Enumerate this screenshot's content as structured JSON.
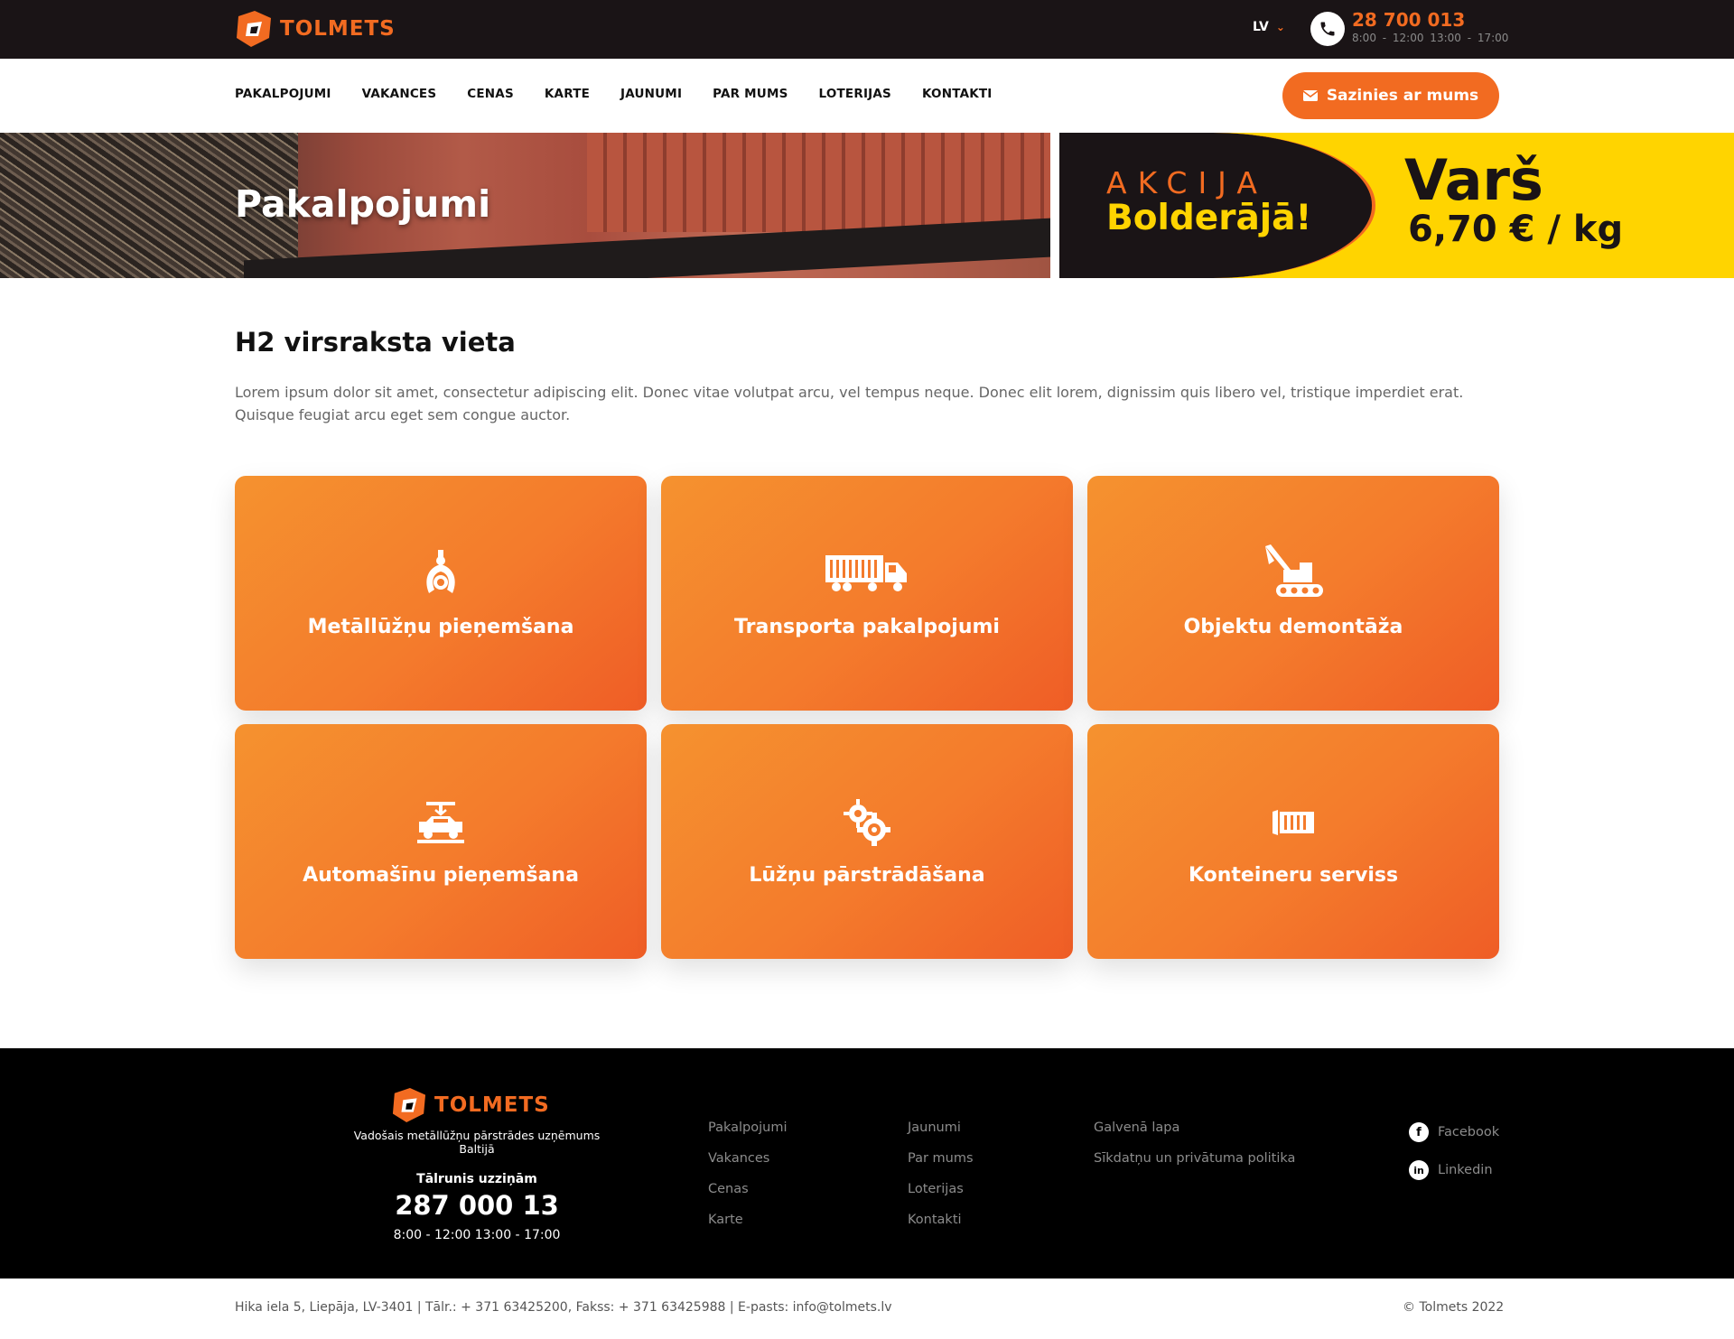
{
  "brand": {
    "name": "TOLMETS",
    "accent": "#f26b21",
    "dark": "#1a1416",
    "yellow": "#ffd400"
  },
  "topbar": {
    "lang": "LV",
    "phone": "28 700 013",
    "hours": "8:00 - 12:00   13:00 - 17:00"
  },
  "nav": {
    "items": [
      "PAKALPOJUMI",
      "VAKANCES",
      "CENAS",
      "KARTE",
      "JAUNUMI",
      "PAR MUMS",
      "LOTERIJAS",
      "KONTAKTI"
    ],
    "contact_button": "Sazinies ar mums"
  },
  "hero": {
    "title": "Pakalpojumi"
  },
  "promo": {
    "line1": "AKCIJA",
    "line2": "Bolderājā!",
    "product": "Varš",
    "price": "6,70 € / kg"
  },
  "content": {
    "heading": "H2 virsraksta vieta",
    "lead": "Lorem ipsum dolor sit amet, consectetur adipiscing elit. Donec vitae volutpat arcu, vel tempus neque. Donec elit lorem, dignissim quis libero vel, tristique imperdiet erat. Quisque feugiat arcu eget sem congue auctor."
  },
  "services": [
    {
      "label": "Metāllūžņu pieņemšana",
      "icon": "claw-grapple-icon"
    },
    {
      "label": "Transporta pakalpojumi",
      "icon": "truck-icon"
    },
    {
      "label": "Objektu demontāža",
      "icon": "excavator-icon"
    },
    {
      "label": "Automašīnu pieņemšana",
      "icon": "car-press-icon"
    },
    {
      "label": "Lūžņu pārstrādāšana",
      "icon": "gears-icon"
    },
    {
      "label": "Konteineru serviss",
      "icon": "container-icon"
    }
  ],
  "footer": {
    "tagline": "Vadošais metāllūžņu pārstrādes uzņēmums Baltijā",
    "phone_label": "Tālrunis uzziņām",
    "phone": "287 000 13",
    "hours": "8:00 - 12:00 13:00 - 17:00",
    "col1": [
      "Pakalpojumi",
      "Vakances",
      "Cenas",
      "Karte"
    ],
    "col2": [
      "Jaunumi",
      "Par mums",
      "Loterijas",
      "Kontakti"
    ],
    "col3": [
      "Galvenā lapa",
      "Sīkdatņu un privātuma politika"
    ],
    "social": [
      "Facebook",
      "Linkedin"
    ]
  },
  "bottom": {
    "address": "Hika iela 5, Liepāja, LV-3401 | Tālr.: + 371 63425200, Fakss: + 371 63425988 | E-pasts: info@tolmets.lv",
    "copyright": "© Tolmets 2022"
  }
}
